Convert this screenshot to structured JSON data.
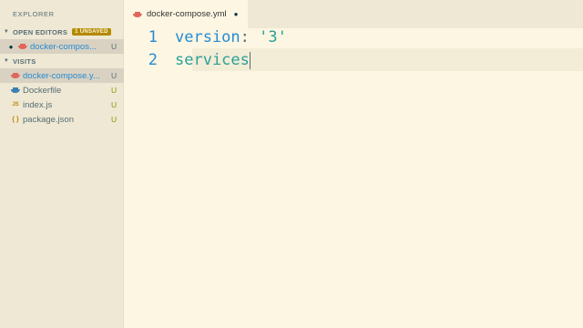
{
  "sidebar": {
    "title": "EXPLORER",
    "open_editors": {
      "label": "OPEN EDITORS",
      "badge": "1 UNSAVED",
      "items": [
        {
          "name": "docker-compos...",
          "status": "U"
        }
      ]
    },
    "visits": {
      "label": "VISITS",
      "items": [
        {
          "name": "docker-compose.y...",
          "status": "U",
          "icon": "docker-icon"
        },
        {
          "name": "Dockerfile",
          "status": "U",
          "icon": "docker-icon"
        },
        {
          "name": "index.js",
          "status": "U",
          "icon": "js-icon",
          "icon_text": "JS"
        },
        {
          "name": "package.json",
          "status": "U",
          "icon": "json-icon",
          "icon_text": "{ }"
        }
      ]
    }
  },
  "tab": {
    "label": "docker-compose.yml",
    "icon": "docker-icon"
  },
  "editor": {
    "lines": [
      {
        "number": "1",
        "key": "version",
        "colon": ":",
        "value": "'3'"
      },
      {
        "number": "2",
        "word": "services"
      }
    ]
  },
  "colors": {
    "accent": "#268bd2",
    "string": "#2aa198",
    "badge": "#b58900",
    "git_untracked": "#859900"
  }
}
